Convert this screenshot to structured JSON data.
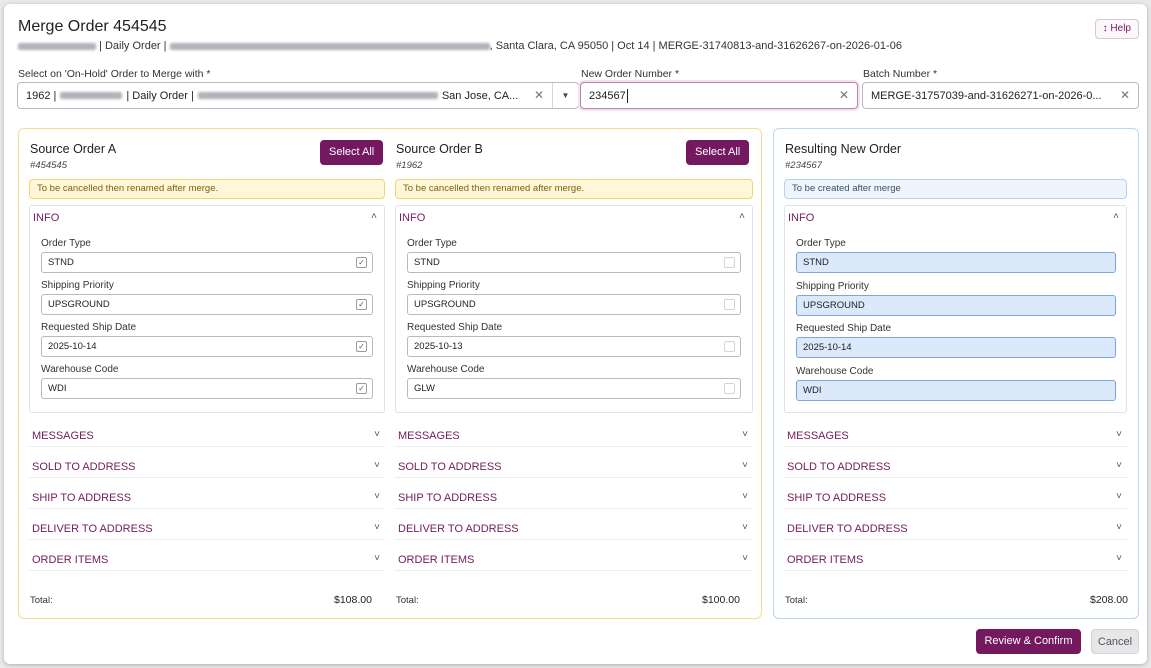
{
  "header": {
    "title": "Merge Order 454545",
    "subtitle_mid": "| Daily Order |",
    "subtitle_end": ", Santa Clara, CA 95050 | Oct 14 | MERGE-31740813-and-31626267-on-2026-01-06",
    "help_label": "↕ Help"
  },
  "form": {
    "merge_label": "Select on 'On-Hold' Order to Merge with *",
    "merge_prefix": "1962 |",
    "merge_mid": "| Daily Order |",
    "merge_end": "San Jose, CA...",
    "new_order_label": "New Order Number *",
    "new_order_value": "234567",
    "batch_label": "Batch Number *",
    "batch_value": "MERGE-31757039-and-31626271-on-2026-0..."
  },
  "source_a": {
    "title": "Source Order A",
    "number": "#454545",
    "select_all": "Select All",
    "notice": "To be cancelled then renamed after merge.",
    "info_title": "INFO",
    "fields": [
      {
        "label": "Order Type",
        "value": "STND",
        "checked": true
      },
      {
        "label": "Shipping Priority",
        "value": "UPSGROUND",
        "checked": true
      },
      {
        "label": "Requested Ship Date",
        "value": "2025-10-14",
        "checked": true
      },
      {
        "label": "Warehouse Code",
        "value": "WDI",
        "checked": true
      }
    ],
    "total_label": "Total:",
    "total_value": "$108.00"
  },
  "source_b": {
    "title": "Source Order B",
    "number": "#1962",
    "select_all": "Select All",
    "notice": "To be cancelled then renamed after merge.",
    "info_title": "INFO",
    "fields": [
      {
        "label": "Order Type",
        "value": "STND",
        "checked": false
      },
      {
        "label": "Shipping Priority",
        "value": "UPSGROUND",
        "checked": false
      },
      {
        "label": "Requested Ship Date",
        "value": "2025-10-13",
        "checked": false
      },
      {
        "label": "Warehouse Code",
        "value": "GLW",
        "checked": false
      }
    ],
    "total_label": "Total:",
    "total_value": "$100.00"
  },
  "result": {
    "title": "Resulting New Order",
    "number": "#234567",
    "notice": "To be created after merge",
    "info_title": "INFO",
    "fields": [
      {
        "label": "Order Type",
        "value": "STND"
      },
      {
        "label": "Shipping Priority",
        "value": "UPSGROUND"
      },
      {
        "label": "Requested Ship Date",
        "value": "2025-10-14"
      },
      {
        "label": "Warehouse Code",
        "value": "WDI"
      }
    ],
    "total_label": "Total:",
    "total_value": "$208.00"
  },
  "sections": [
    "MESSAGES",
    "SOLD TO ADDRESS",
    "SHIP TO ADDRESS",
    "DELIVER TO ADDRESS",
    "ORDER ITEMS"
  ],
  "icons": {
    "chevron_up": "˄",
    "chevron_down": "˅",
    "clear": "✕",
    "dropdown": "▼",
    "checkbox_checked": "✓"
  },
  "footer": {
    "confirm_label": "Review & Confirm",
    "cancel_label": "Cancel"
  },
  "colors": {
    "brand": "#74195f",
    "source_border": "#f3de92",
    "result_border": "#bcd6ef",
    "result_field_bg": "#dbe9fb"
  }
}
